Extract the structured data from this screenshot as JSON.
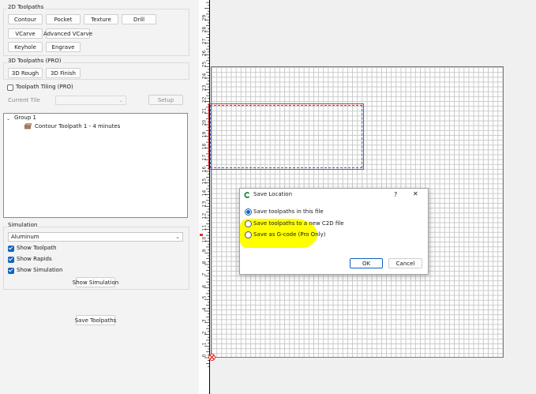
{
  "toolpaths2d": {
    "title": "2D Toolpaths",
    "buttons": [
      "Contour",
      "Pocket",
      "Texture",
      "Drill",
      "VCarve",
      "Advanced VCarve",
      "Keyhole",
      "Engrave"
    ]
  },
  "toolpaths3d": {
    "title": "3D Toolpaths (PRO)",
    "buttons": [
      "3D Rough",
      "3D Finish"
    ]
  },
  "tiling": {
    "checkbox_label": "Toolpath Tiling (PRO)",
    "checked": false,
    "current_tile_label": "Current Tile",
    "current_tile_value": "",
    "setup_label": "Setup"
  },
  "tree": {
    "group_label": "Group 1",
    "item_label": "Contour Toolpath 1 - 4 minutes"
  },
  "simulation": {
    "title": "Simulation",
    "material": "Aluminum",
    "show_toolpath": "Show Toolpath",
    "show_rapids": "Show Rapids",
    "show_simulation": "Show Simulation",
    "show_simulation_button": "Show Simulation"
  },
  "save_toolpaths_button": "Save Toolpaths",
  "ruler": {
    "labels": [
      "0",
      "1",
      "2",
      "3",
      "4",
      "5",
      "6",
      "7",
      "8",
      "9",
      "10",
      "11",
      "12",
      "13",
      "14",
      "15",
      "16",
      "17",
      "18",
      "19",
      "20",
      "21",
      "22",
      "23",
      "24",
      "25",
      "26",
      "27",
      "28",
      "29"
    ]
  },
  "dialog": {
    "title": "Save Location",
    "help": "?",
    "close": "✕",
    "options": [
      "Save toolpaths in this file",
      "Save toolpaths to a new C2D file",
      "Save as G-code (Pro Only)"
    ],
    "selected_index": 0,
    "ok": "OK",
    "cancel": "Cancel"
  },
  "colors": {
    "accent": "#1064c0",
    "highlight": "#ffff00",
    "toolpath_red": "#e0302a",
    "toolpath_blue": "#4060c8"
  }
}
